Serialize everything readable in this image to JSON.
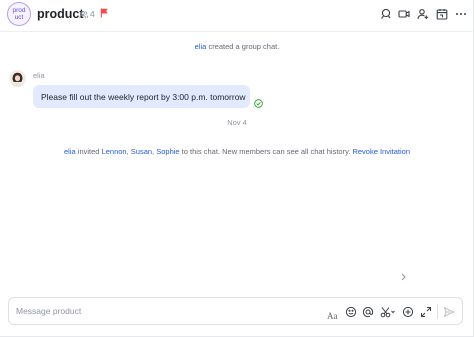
{
  "header": {
    "avatar_text": "prod uct",
    "title": "product",
    "member_count": "4",
    "icons": [
      "search-icon",
      "video-call-icon",
      "add-member-icon",
      "calendar-icon",
      "more-icon"
    ]
  },
  "messages": {
    "created": {
      "user": "elia",
      "text": "created a group chat."
    },
    "sender_name": "elia",
    "bubble_text": "Please fill out the weekly report by 3:00 p.m. tomorrow",
    "date_separator": "Nov 4",
    "invited": {
      "user": "elia",
      "verb": "invited",
      "invitees": [
        "Lennon",
        "Susan",
        "Sophie"
      ],
      "sep": ", ",
      "rest": "to this chat. New members can see all chat history.",
      "revoke": "Revoke Invitation"
    }
  },
  "composer": {
    "placeholder": "Message product",
    "tools": [
      "font-icon",
      "emoji-icon",
      "mention-icon",
      "scissors-icon",
      "add-icon",
      "expand-icon",
      "send-icon"
    ],
    "font_glyph": "Aa"
  },
  "colors": {
    "link": "#245bdb",
    "bubble": "#e1eaff",
    "flag": "#f54a45",
    "read": "#2ea121"
  }
}
